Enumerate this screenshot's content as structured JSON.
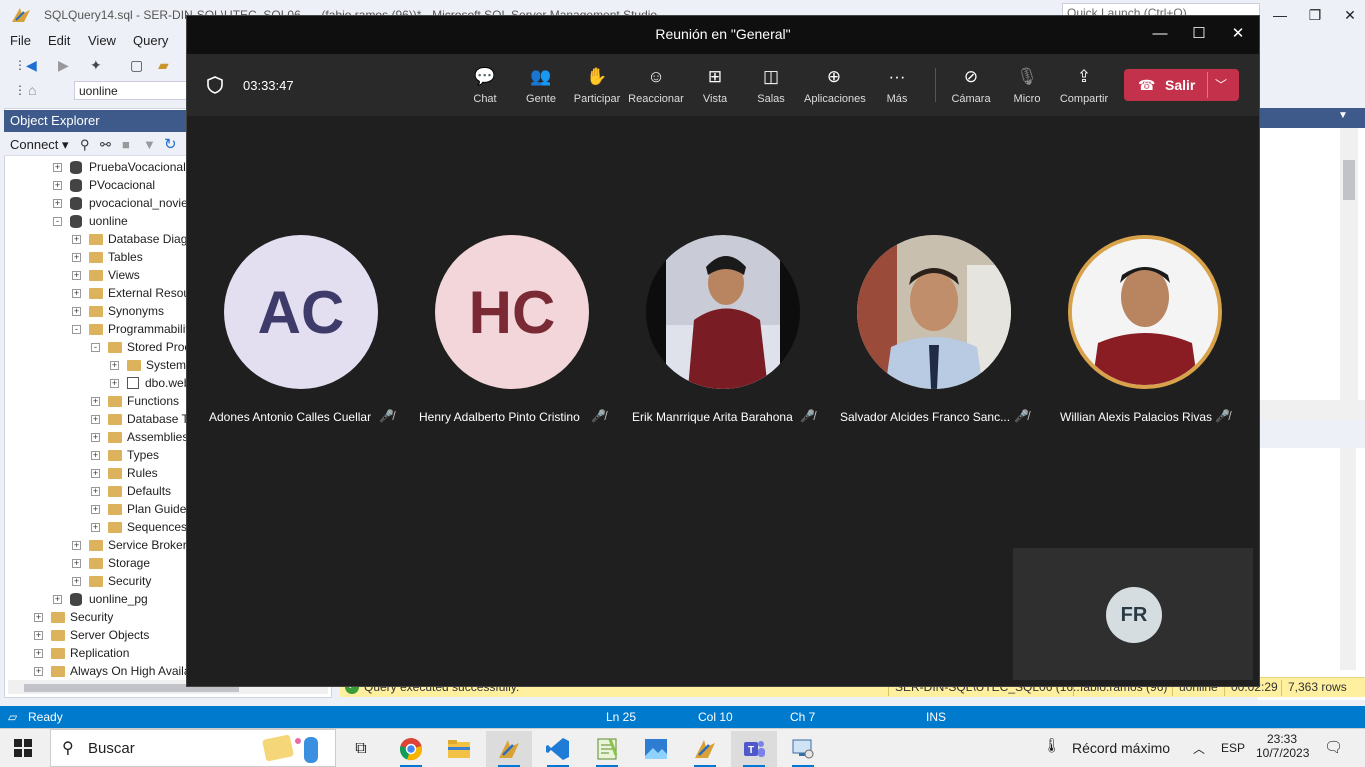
{
  "ssms": {
    "window_title": "SQLQuery14.sql - SER-DIN-SQL\\UTEC_SQL06 - ...(fabio.ramos (96))* - Microsoft SQL Server Management Studio",
    "quick_launch_placeholder": "Quick Launch (Ctrl+Q)",
    "menu": [
      "File",
      "Edit",
      "View",
      "Query"
    ],
    "database_combo": "uonline",
    "object_explorer": {
      "title": "Object Explorer",
      "connect_label": "Connect",
      "tree": [
        {
          "label": "PruebaVocacional",
          "type": "db",
          "level": 2,
          "expander": "+"
        },
        {
          "label": "PVocacional",
          "type": "db",
          "level": 2,
          "expander": "+"
        },
        {
          "label": "pvocacional_noviembre",
          "type": "db",
          "level": 2,
          "expander": "+"
        },
        {
          "label": "uonline",
          "type": "db",
          "level": 2,
          "expander": "-"
        },
        {
          "label": "Database Diagrams",
          "type": "folder",
          "level": 3,
          "expander": "+"
        },
        {
          "label": "Tables",
          "type": "folder",
          "level": 3,
          "expander": "+"
        },
        {
          "label": "Views",
          "type": "folder",
          "level": 3,
          "expander": "+"
        },
        {
          "label": "External Resources",
          "type": "folder",
          "level": 3,
          "expander": "+"
        },
        {
          "label": "Synonyms",
          "type": "folder",
          "level": 3,
          "expander": "+"
        },
        {
          "label": "Programmability",
          "type": "folder",
          "level": 3,
          "expander": "-"
        },
        {
          "label": "Stored Procedures",
          "type": "folder",
          "level": 4,
          "expander": "-"
        },
        {
          "label": "System Stored Procedures",
          "type": "folder",
          "level": 5,
          "expander": "+"
        },
        {
          "label": "dbo.web",
          "type": "sp",
          "level": 5,
          "expander": "+"
        },
        {
          "label": "Functions",
          "type": "folder",
          "level": 4,
          "expander": "+"
        },
        {
          "label": "Database Triggers",
          "type": "folder",
          "level": 4,
          "expander": "+"
        },
        {
          "label": "Assemblies",
          "type": "folder",
          "level": 4,
          "expander": "+"
        },
        {
          "label": "Types",
          "type": "folder",
          "level": 4,
          "expander": "+"
        },
        {
          "label": "Rules",
          "type": "folder",
          "level": 4,
          "expander": "+"
        },
        {
          "label": "Defaults",
          "type": "folder",
          "level": 4,
          "expander": "+"
        },
        {
          "label": "Plan Guides",
          "type": "folder",
          "level": 4,
          "expander": "+"
        },
        {
          "label": "Sequences",
          "type": "folder",
          "level": 4,
          "expander": "+"
        },
        {
          "label": "Service Broker",
          "type": "folder",
          "level": 3,
          "expander": "+"
        },
        {
          "label": "Storage",
          "type": "folder",
          "level": 3,
          "expander": "+"
        },
        {
          "label": "Security",
          "type": "folder",
          "level": 3,
          "expander": "+"
        },
        {
          "label": "uonline_pg",
          "type": "db",
          "level": 2,
          "expander": "+"
        },
        {
          "label": "Security",
          "type": "folder",
          "level": 1,
          "expander": "+"
        },
        {
          "label": "Server Objects",
          "type": "folder",
          "level": 1,
          "expander": "+"
        },
        {
          "label": "Replication",
          "type": "folder",
          "level": 1,
          "expander": "+"
        },
        {
          "label": "Always On High Availability",
          "type": "folder",
          "level": 1,
          "expander": "+"
        }
      ]
    },
    "query_status": {
      "message": "Query executed successfully.",
      "server": "SER-DIN-SQL\\UTEC_SQL06 (16...",
      "user": "fabio.ramos (96)",
      "database": "uonline",
      "elapsed": "00:02:29",
      "rows": "7,363 rows"
    },
    "status_bar": {
      "ready": "Ready",
      "line": "Ln 25",
      "col": "Col 10",
      "ch": "Ch 7",
      "mode": "INS"
    }
  },
  "teams": {
    "title": "Reunión en \"General\"",
    "timer": "03:33:47",
    "toolbar": [
      {
        "label": "Chat",
        "icon": "chat-icon",
        "glyph": "💬"
      },
      {
        "label": "Gente",
        "icon": "people-icon",
        "glyph": "👥"
      },
      {
        "label": "Participar",
        "icon": "raise-hand-icon",
        "glyph": "✋"
      },
      {
        "label": "Reaccionar",
        "icon": "smile-icon",
        "glyph": "☺"
      },
      {
        "label": "Vista",
        "icon": "grid-icon",
        "glyph": "⊞"
      },
      {
        "label": "Salas",
        "icon": "rooms-icon",
        "glyph": "◫"
      },
      {
        "label": "Aplicaciones",
        "icon": "add-apps-icon",
        "glyph": "⊕"
      },
      {
        "label": "Más",
        "icon": "more-icon",
        "glyph": "···"
      },
      {
        "label": "Cámara",
        "icon": "camera-off-icon",
        "glyph": "⊘"
      },
      {
        "label": "Micro",
        "icon": "mic-off-icon",
        "glyph": "🎙"
      },
      {
        "label": "Compartir",
        "icon": "share-icon",
        "glyph": "⇪"
      }
    ],
    "leave_label": "Salir",
    "participants": [
      {
        "name": "Adones Antonio Calles Cuellar",
        "initials": "AC",
        "avatar_bg": "#e3dff0",
        "avatar_fg": "#3e3a6a"
      },
      {
        "name": "Henry Adalberto Pinto Cristino",
        "initials": "HC",
        "avatar_bg": "#f2d6d9",
        "avatar_fg": "#7a2a35"
      },
      {
        "name": "Erik Manrrique Arita Barahona",
        "initials": "",
        "avatar_bg": "#111111",
        "avatar_fg": "#ffffff"
      },
      {
        "name": "Salvador Alcides Franco Sanc...",
        "initials": "",
        "avatar_bg": "#8a8f98",
        "avatar_fg": "#ffffff"
      },
      {
        "name": "Willian Alexis Palacios Rivas",
        "initials": "",
        "avatar_bg": "#f3f3f3",
        "avatar_fg": "#ffffff"
      }
    ],
    "self_initials": "FR"
  },
  "taskbar": {
    "search_placeholder": "Buscar",
    "weather": "Récord máximo",
    "language": "ESP",
    "time": "23:33",
    "date": "10/7/2023"
  },
  "colors": {
    "teams_bg": "#1f1f1f",
    "teams_toolbar": "#292929",
    "leave_red": "#c4314b",
    "ssms_status_blue": "#007acc",
    "oe_header": "#3d5a8a"
  }
}
